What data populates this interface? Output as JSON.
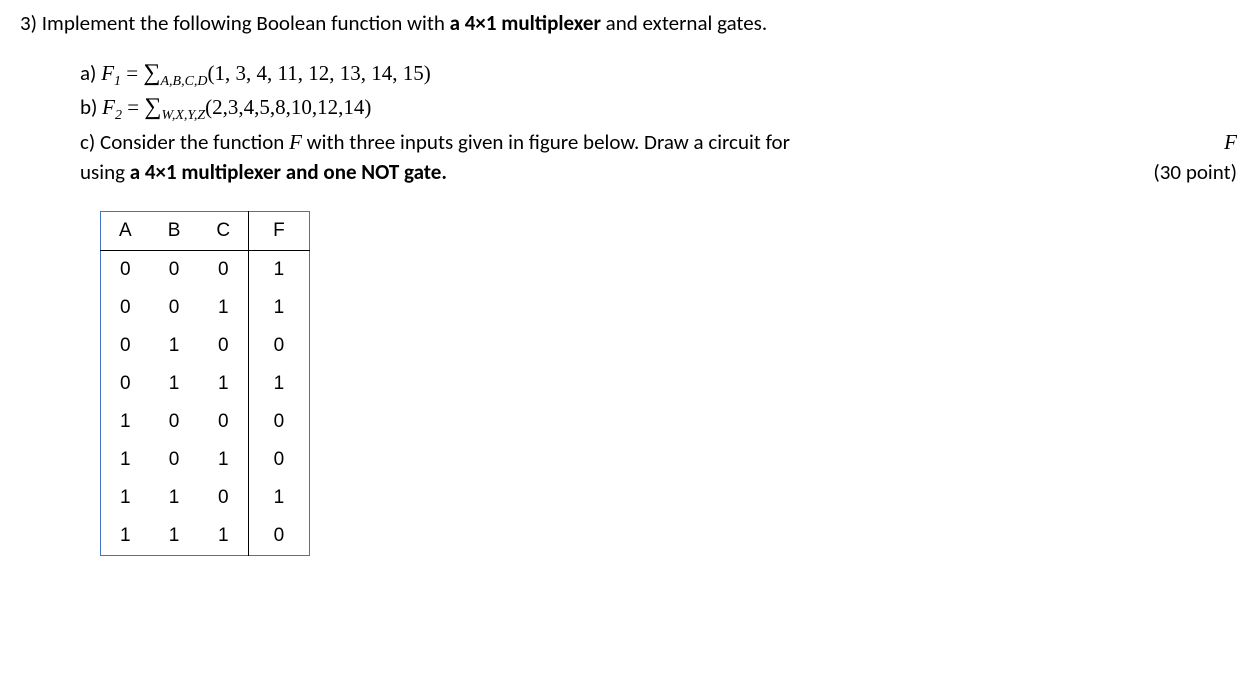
{
  "problem": {
    "number": "3)",
    "intro_before_bold": "Implement the following Boolean function with ",
    "bold_phrase": "a 4×1 multiplexer",
    "intro_after_bold": " and external gates."
  },
  "parts": {
    "a": {
      "label": "a) ",
      "func": "F",
      "func_sub": "1",
      "equals": " = ",
      "sigma": "∑",
      "sigma_sub": "A,B,C,D",
      "minterms": "(1, 3, 4, 11, 12, 13, 14, 15)"
    },
    "b": {
      "label": "b) ",
      "func": "F",
      "func_sub": "2",
      "equals": " = ",
      "sigma": "∑",
      "sigma_sub": "W,X,Y,Z",
      "minterms": "(2,3,4,5,8,10,12,14)"
    },
    "c": {
      "label": "c) ",
      "text_before_F": "Consider the function ",
      "F_symbol": "F",
      "text_mid": " with three inputs given in figure below. Draw a circuit for ",
      "F_symbol2": "F",
      "text_before_bold": " using ",
      "bold_text": "a 4×1 multiplexer and one NOT gate.",
      "points": "(30 point)"
    }
  },
  "table": {
    "headers": [
      "A",
      "B",
      "C",
      "F"
    ],
    "rows": [
      [
        "0",
        "0",
        "0",
        "1"
      ],
      [
        "0",
        "0",
        "1",
        "1"
      ],
      [
        "0",
        "1",
        "0",
        "0"
      ],
      [
        "0",
        "1",
        "1",
        "1"
      ],
      [
        "1",
        "0",
        "0",
        "0"
      ],
      [
        "1",
        "0",
        "1",
        "0"
      ],
      [
        "1",
        "1",
        "0",
        "1"
      ],
      [
        "1",
        "1",
        "1",
        "0"
      ]
    ]
  }
}
